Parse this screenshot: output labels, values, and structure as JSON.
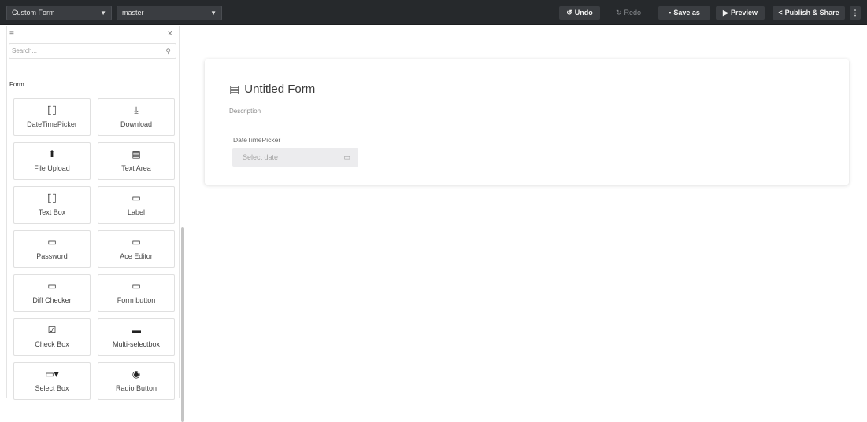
{
  "topbar": {
    "form_select": "Custom Form",
    "branch_select": "master",
    "undo": "Undo",
    "redo": "Redo",
    "save_as": "Save as",
    "preview": "Preview",
    "publish": "Publish & Share",
    "more": "⋮"
  },
  "sidebar": {
    "search_placeholder": "Search...",
    "section": "Form",
    "components": [
      {
        "label": "DateTimePicker",
        "icon": "datetime-icon"
      },
      {
        "label": "Download",
        "icon": "download-icon"
      },
      {
        "label": "File Upload",
        "icon": "upload-icon"
      },
      {
        "label": "Text Area",
        "icon": "textarea-icon"
      },
      {
        "label": "Text Box",
        "icon": "textbox-icon"
      },
      {
        "label": "Label",
        "icon": "label-icon"
      },
      {
        "label": "Password",
        "icon": "password-icon"
      },
      {
        "label": "Ace Editor",
        "icon": "editor-icon"
      },
      {
        "label": "Diff Checker",
        "icon": "diff-icon"
      },
      {
        "label": "Form button",
        "icon": "button-icon"
      },
      {
        "label": "Check Box",
        "icon": "checkbox-icon"
      },
      {
        "label": "Multi-selectbox",
        "icon": "multiselect-icon"
      },
      {
        "label": "Select Box",
        "icon": "selectbox-icon"
      },
      {
        "label": "Radio Button",
        "icon": "radio-icon"
      }
    ]
  },
  "canvas": {
    "title": "Untitled Form",
    "description": "Description",
    "field_label": "DateTimePicker",
    "date_placeholder": "Select date"
  }
}
